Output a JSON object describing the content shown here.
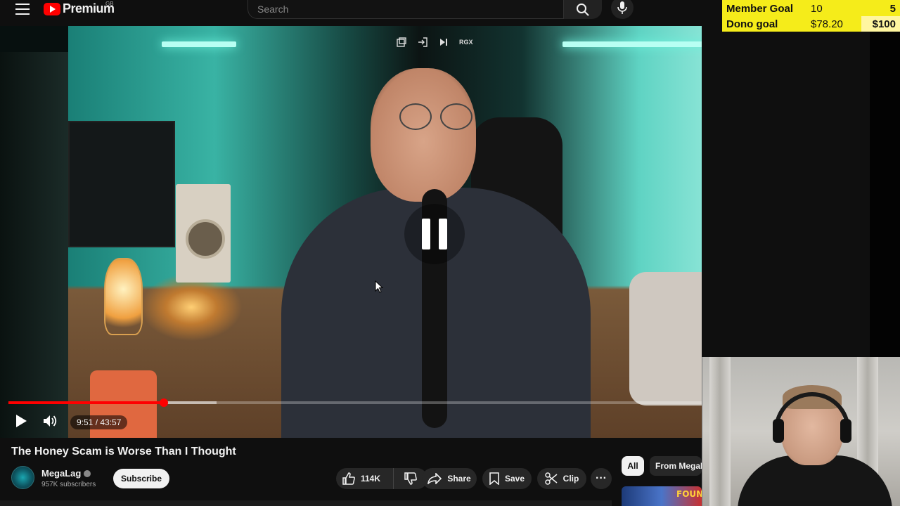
{
  "topbar": {
    "logo_text": "Premium",
    "logo_country": "GB",
    "search_placeholder": "Search"
  },
  "stream_overlay": {
    "member_goal_label": "Member Goal",
    "member_goal_current": "10",
    "member_goal_target": "5",
    "dono_goal_label": "Dono goal",
    "dono_goal_current": "$78.20",
    "dono_goal_target": "$100",
    "colors": {
      "background": "#f5ec1a",
      "highlight": "#fff6a0"
    }
  },
  "player": {
    "overlay_badge": "RGX",
    "time_display": "9:51 / 43:57",
    "progress_fraction": 0.2245,
    "buffer_fraction": 0.3,
    "state": "paused-indicator",
    "colors": {
      "progress": "#ff0000"
    }
  },
  "video": {
    "title": "The Honey Scam is Worse Than I Thought",
    "channel_name": "MegaLag",
    "subscribers": "957K subscribers",
    "subscribe_label": "Subscribe",
    "likes": "114K",
    "share_label": "Share",
    "save_label": "Save",
    "clip_label": "Clip",
    "more_label": "···"
  },
  "recommendations": {
    "chips": [
      "All",
      "From MegaLag"
    ],
    "thumb_text": "FOUN"
  },
  "icons": [
    "menu-icon",
    "youtube-logo-icon",
    "search-icon",
    "mic-icon",
    "miniplayer-icon",
    "exit-icon",
    "skip-icon",
    "pause-icon",
    "play-icon",
    "volume-icon",
    "like-icon",
    "dislike-icon",
    "share-icon",
    "save-icon",
    "clip-icon",
    "more-icon",
    "verified-icon",
    "cursor-icon"
  ]
}
